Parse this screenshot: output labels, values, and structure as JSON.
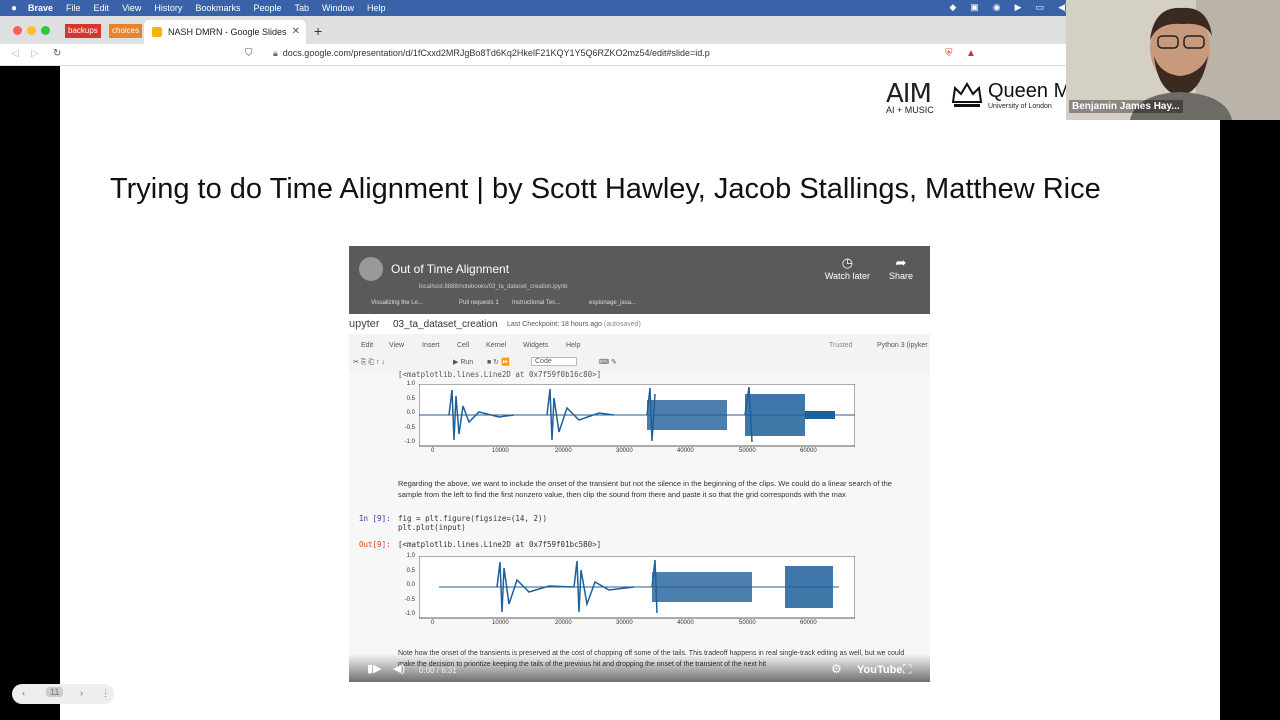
{
  "menubar": {
    "app": "Brave",
    "items": [
      "File",
      "Edit",
      "View",
      "History",
      "Bookmarks",
      "People",
      "Tab",
      "Window",
      "Help"
    ]
  },
  "tabbar": {
    "tags": [
      "backups",
      "choices"
    ],
    "active_tab": "NASH DMRN - Google Slides"
  },
  "toolbar": {
    "url": "docs.google.com/presentation/d/1fCxxd2MRJgBo8Td6Kq2HkelF21KQY1Y5Q6RZKO2mz54/edit#slide=id.p"
  },
  "slide": {
    "title": "Trying to do Time Alignment | by Scott Hawley, Jacob Stallings, Matthew Rice",
    "logo_aim": "AIM",
    "logo_aim_sub": "AI + MUSIC",
    "logo_qm": "Queen Mar",
    "logo_qm_sub": "University of London"
  },
  "video": {
    "title": "Out of Time Alignment",
    "watch_later": "Watch later",
    "share": "Share",
    "addr": "localhost:8888/notebooks/03_ta_dataset_creation.ipynb",
    "bookmarks": [
      "Visualizing the Le...",
      "Pull requests 1",
      "Instructional Tec...",
      "espionage_jasa..."
    ],
    "jupyter_logo": "upyter",
    "notebook_name": "03_ta_dataset_creation",
    "checkpoint": "Last Checkpoint: 18 hours ago",
    "autosaved": "(autosaved)",
    "menu": [
      "Edit",
      "View",
      "Insert",
      "Cell",
      "Kernel",
      "Widgets",
      "Help"
    ],
    "trusted": "Trusted",
    "kernel": "Python 3 (ipyker",
    "run_label": "Run",
    "celltype": "Code",
    "top_output": "[<matplotlib.lines.Line2D at 0x7f59f0b16c80>]",
    "markdown": "Regarding the above, we want to include the onset of the transient but not the silence in the beginning of the clips. We could do a linear search of the sample from the left to find the first nonzero value, then clip the sound from there and paste it so that the grid corresponds with the max",
    "in_prompt": "In [9]:",
    "code_line1": "fig = plt.figure(figsize=(14, 2))",
    "code_line2": "plt.plot(input)",
    "out_prompt": "Out[9]:",
    "output": "[<matplotlib.lines.Line2D at 0x7f59f01bc5B0>]",
    "bottom_text": "Note how the onset of the transients is preserved at the cost of chopping off some of the tails. This tradeoff happens in real single-track editing as well, but we could make the decision to prioritize keeping the tails of the previous hit and dropping the onset of the transient of the next hit",
    "time": "0:00 / 6:31",
    "youtube": "YouTube",
    "y_ticks": [
      "1.0",
      "0.5",
      "0.0",
      "-0.5",
      "-1.0"
    ],
    "x_ticks": [
      "0",
      "10000",
      "20000",
      "30000",
      "40000",
      "50000",
      "60000"
    ]
  },
  "webcam": {
    "name": "Benjamin James Hay..."
  },
  "slidenav": {
    "page": "11"
  }
}
